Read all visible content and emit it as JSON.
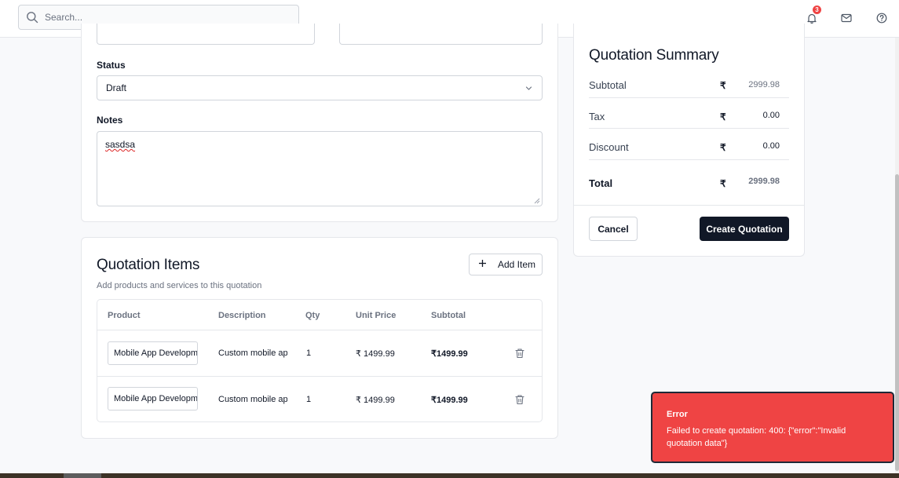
{
  "header": {
    "search_placeholder": "Search...",
    "notification_count": "3"
  },
  "form": {
    "status_label": "Status",
    "status_value": "Draft",
    "notes_label": "Notes",
    "notes_value": "sasdsa"
  },
  "items": {
    "title": "Quotation Items",
    "subtitle": "Add products and services to this quotation",
    "add_button": "Add Item",
    "columns": [
      "Product",
      "Description",
      "Qty",
      "Unit Price",
      "Subtotal"
    ],
    "rows": [
      {
        "product": "Mobile App Development",
        "description": "Custom mobile app",
        "qty": "1",
        "unit_price": "₹ 1499.99",
        "subtotal": "₹1499.99"
      },
      {
        "product": "Mobile App Development",
        "description": "Custom mobile app",
        "qty": "1",
        "unit_price": "₹ 1499.99",
        "subtotal": "₹1499.99"
      }
    ]
  },
  "summary": {
    "title": "Quotation Summary",
    "currency": "₹",
    "subtotal_label": "Subtotal",
    "subtotal_value": "2999.98",
    "tax_label": "Tax",
    "tax_value": "0.00",
    "discount_label": "Discount",
    "discount_value": "0.00",
    "total_label": "Total",
    "total_value": "2999.98",
    "cancel_button": "Cancel",
    "create_button": "Create Quotation"
  },
  "toast": {
    "title": "Error",
    "message": "Failed to create quotation: 400: {\"error\":\"Invalid quotation data\"}"
  },
  "colors": {
    "primary": "#111827",
    "error": "#ef4444",
    "border": "#e5e7eb",
    "muted": "#6b7280"
  }
}
